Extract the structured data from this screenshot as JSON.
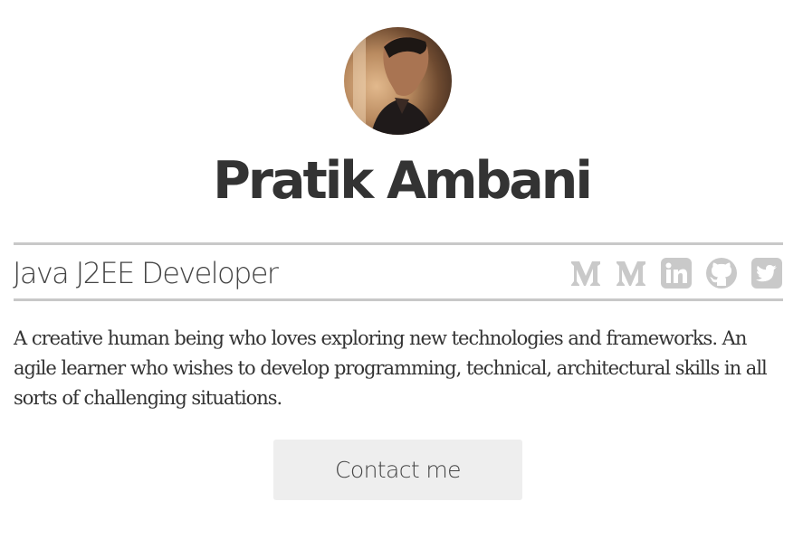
{
  "profile": {
    "avatar_alt": "Pratik Ambani",
    "name": "Pratik Ambani",
    "role": "Java J2EE Developer",
    "bio": "A creative human being who loves exploring new technologies and frameworks. An agile learner who wishes to develop programming, technical, architectural skills in all sorts of challenging situations."
  },
  "socials": [
    {
      "icon": "medium-icon",
      "label": "Medium"
    },
    {
      "icon": "medium-icon",
      "label": "Medium"
    },
    {
      "icon": "linkedin-icon",
      "label": "LinkedIn"
    },
    {
      "icon": "github-icon",
      "label": "GitHub"
    },
    {
      "icon": "twitter-icon",
      "label": "Twitter"
    }
  ],
  "contact_button": {
    "label": "Contact me"
  },
  "colors": {
    "text": "#333333",
    "rule": "#c8c8c8",
    "icon": "#c9c9c9",
    "button_bg": "#eeeeee"
  }
}
